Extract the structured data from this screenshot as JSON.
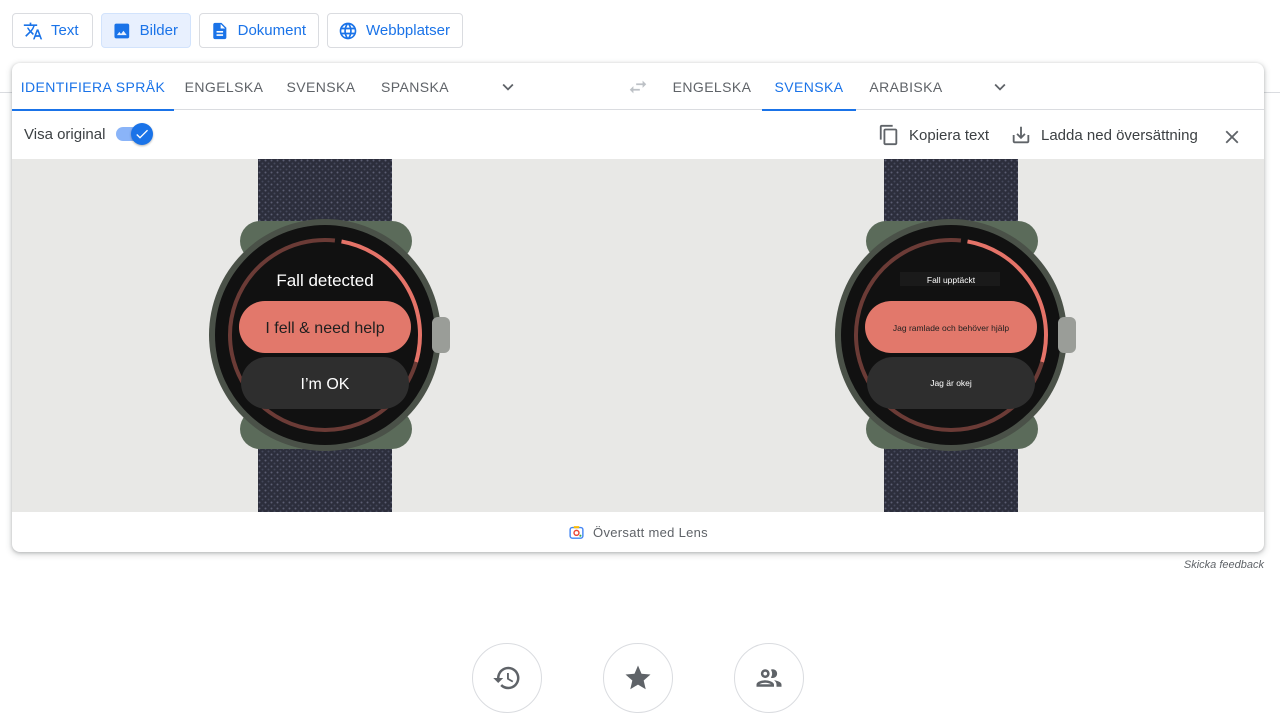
{
  "modes": {
    "text": "Text",
    "images": "Bilder",
    "documents": "Dokument",
    "websites": "Webbplatser"
  },
  "source_langs": [
    "IDENTIFIERA SPRÅK",
    "ENGELSKA",
    "SVENSKA",
    "SPANSKA"
  ],
  "target_langs": [
    "ENGELSKA",
    "SVENSKA",
    "ARABISKA"
  ],
  "toolbar": {
    "show_original": "Visa original",
    "copy_text": "Kopiera text",
    "download": "Ladda ned översättning"
  },
  "original_watch": {
    "title": "Fall detected",
    "primary": "I fell & need help",
    "secondary": "I’m OK"
  },
  "translated_watch": {
    "title": "Fall upptäckt",
    "primary": "Jag ramlade och behöver hjälp",
    "secondary": "Jag är okej"
  },
  "lens_caption": "Översatt med Lens",
  "feedback": "Skicka feedback",
  "colors": {
    "accent": "#1a73e8",
    "watch_button": "#e2786b",
    "ring": "#e57368"
  }
}
